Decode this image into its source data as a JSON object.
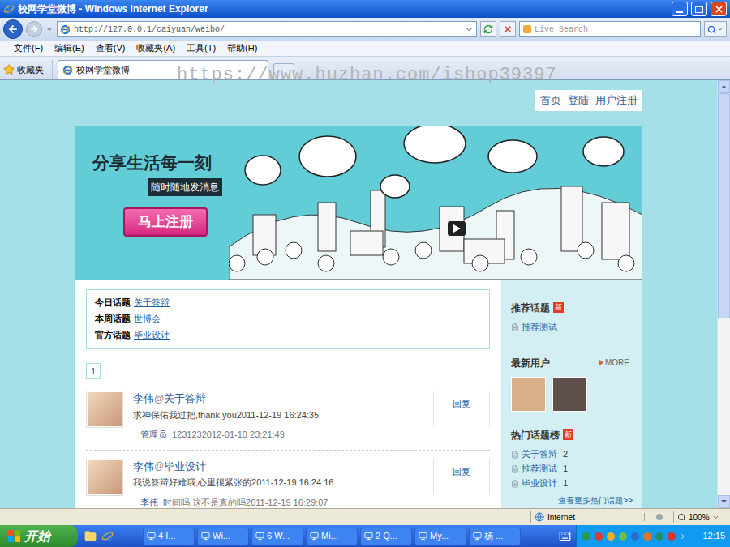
{
  "window": {
    "title": "校网学堂微博 - Windows Internet Explorer"
  },
  "address_bar": {
    "url": "http://127.0.0.1/caiyuan/weibo/"
  },
  "search": {
    "placeholder": "Live Search"
  },
  "menu": [
    "文件(F)",
    "编辑(E)",
    "查看(V)",
    "收藏夹(A)",
    "工具(T)",
    "帮助(H)"
  ],
  "favorites": {
    "label": "收藏夹"
  },
  "tabs": [
    {
      "label": "校网学堂微博",
      "selected": true
    }
  ],
  "watermark": "https://www.huzhan.com/ishop39397",
  "scrollbar": {
    "level": 0.56
  },
  "page": {
    "nav": [
      "首页",
      "登陆",
      "用户注册"
    ],
    "banner": {
      "headline": "分享生活每一刻",
      "subline": "随时随地发消息",
      "button": "马上注册"
    },
    "topics": [
      {
        "label": "今日话题",
        "topic": "关于答辩"
      },
      {
        "label": "本周话题",
        "topic": "世博会"
      },
      {
        "label": "官方话题",
        "topic": "毕业设计"
      }
    ],
    "pagination": [
      {
        "label": "1",
        "selected": true
      }
    ],
    "posts": [
      {
        "user": "李伟",
        "at": "@",
        "topic": "关于答辩",
        "content": "求神保佑我过把,thank you2011-12-19 16:24:35",
        "reply": "回复",
        "comment": {
          "user": "管理员",
          "text": "1231232012-01-10 23:21:49"
        }
      },
      {
        "user": "李伟",
        "at": "@",
        "topic": "毕业设计",
        "content": "我说答辩好难哦,心里很紧张的2011-12-19 16:24:16",
        "reply": "回复",
        "comment": {
          "user": "李伟",
          "text": "时间吗,这不是真的吗2011-12-19 16:29:07"
        }
      }
    ],
    "sidebar": {
      "recommended": {
        "title": "推荐话题",
        "badge": "新",
        "items": [
          "推荐测试"
        ]
      },
      "new_users": {
        "title": "最新用户",
        "more": "MORE",
        "users": [
          {
            "color": "#d8b08a"
          },
          {
            "color": "#5e4f4a"
          }
        ]
      },
      "hot": {
        "title": "热门话题榜",
        "badge": "新",
        "items": [
          {
            "label": "关于答辩",
            "count": "2"
          },
          {
            "label": "推荐测试",
            "count": "1"
          },
          {
            "label": "毕业设计",
            "count": "1"
          }
        ],
        "more": "查看更多热门话题>>"
      }
    }
  },
  "status_bar": {
    "zone": "Internet",
    "zoom": "100%"
  },
  "taskbar": {
    "start": "开始",
    "tasks": [
      "4 I...",
      "Wi...",
      "6 W...",
      "Mi...",
      "2 Q...",
      "My...",
      "杨 ..."
    ],
    "clock": "12:15"
  }
}
